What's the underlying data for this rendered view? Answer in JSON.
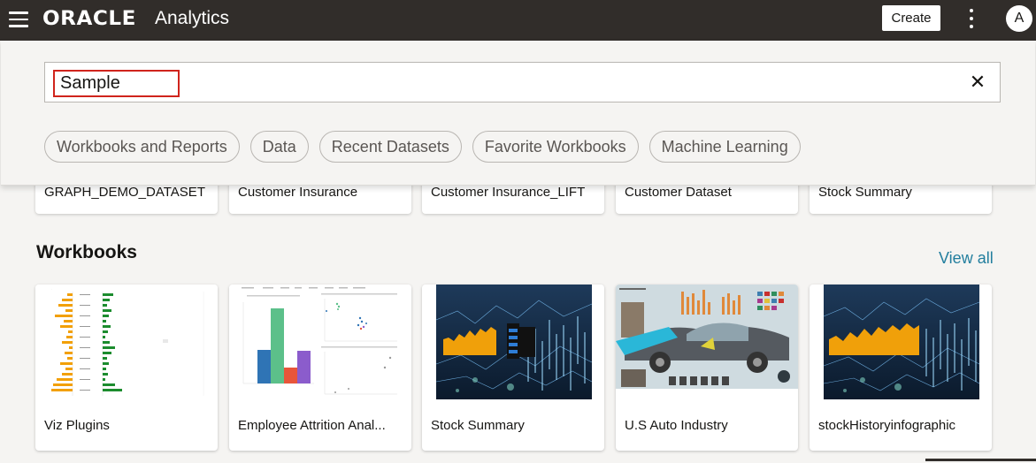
{
  "header": {
    "logo": "ORACLE",
    "app_name": "Analytics",
    "create_label": "Create",
    "avatar_initial": "A"
  },
  "search": {
    "value": "Sample",
    "clear_icon": "close-icon"
  },
  "chips": [
    {
      "label": "Workbooks and Reports"
    },
    {
      "label": "Data"
    },
    {
      "label": "Recent Datasets"
    },
    {
      "label": "Favorite Workbooks"
    },
    {
      "label": "Machine Learning"
    }
  ],
  "datasets": [
    {
      "label": "GRAPH_DEMO_DATASET"
    },
    {
      "label": "Customer Insurance"
    },
    {
      "label": "Customer Insurance_LIFT"
    },
    {
      "label": "Customer Dataset"
    },
    {
      "label": "Stock Summary"
    }
  ],
  "workbooks_section": {
    "title": "Workbooks",
    "view_all": "View all"
  },
  "workbooks": [
    {
      "label": "Viz Plugins",
      "thumb": "bar-chart-thumbnail"
    },
    {
      "label": "Employee Attrition Anal...",
      "thumb": "bar-scatter-thumbnail"
    },
    {
      "label": "Stock Summary",
      "thumb": "stock-image-thumbnail"
    },
    {
      "label": "U.S Auto Industry",
      "thumb": "car-infographic-thumbnail"
    },
    {
      "label": "stockHistoryinfographic",
      "thumb": "stock-image-thumbnail"
    }
  ],
  "colors": {
    "header_bg": "#312d2a",
    "link": "#227e9e",
    "search_highlight": "#d0241c"
  }
}
